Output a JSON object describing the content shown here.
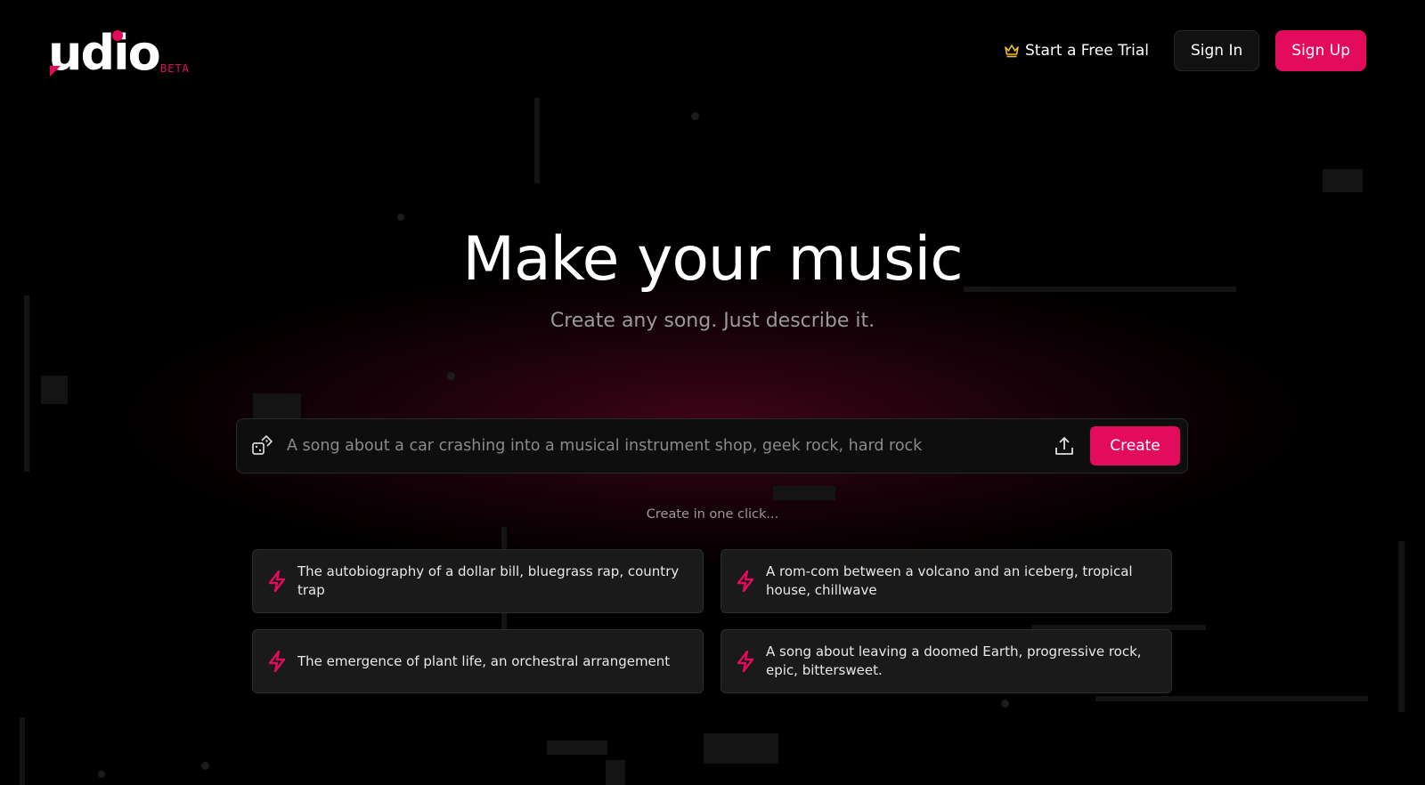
{
  "brand": {
    "logo_text": "udio",
    "beta_label": "BETA",
    "accent_color": "#e30b5c"
  },
  "nav": {
    "trial_label": "Start a Free Trial",
    "trial_icon": "crown-icon",
    "signin_label": "Sign In",
    "signup_label": "Sign Up"
  },
  "hero": {
    "title": "Make your music",
    "subtitle": "Create any song. Just describe it."
  },
  "prompt": {
    "placeholder": "A song about a car crashing into a musical instrument shop, geek rock, hard rock",
    "value": "",
    "random_icon": "dice-icon",
    "upload_icon": "upload-icon",
    "create_label": "Create"
  },
  "suggestions": {
    "heading": "Create in one click...",
    "icon": "bolt-icon",
    "items": [
      {
        "text": "The autobiography of a dollar bill, bluegrass rap, country trap"
      },
      {
        "text": "A rom-com between a volcano and an iceberg, tropical house, chillwave"
      },
      {
        "text": "The emergence of plant life, an orchestral arrangement"
      },
      {
        "text": "A song about leaving a doomed Earth, progressive rock, epic, bittersweet."
      }
    ]
  }
}
